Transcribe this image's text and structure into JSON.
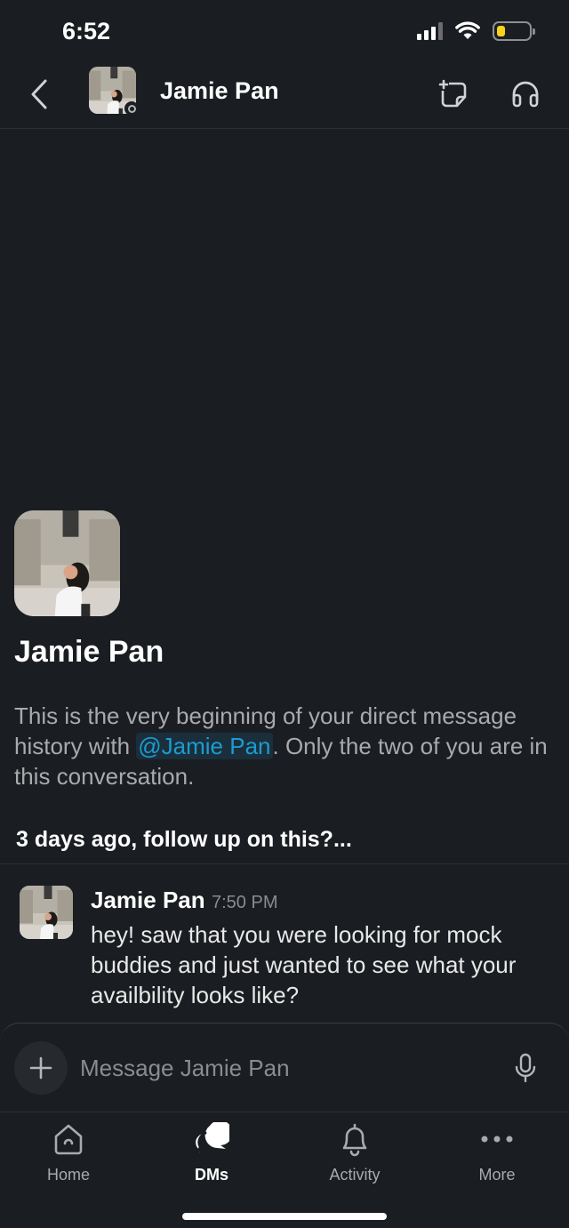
{
  "status_bar": {
    "time": "6:52",
    "battery_level": 0.22
  },
  "header": {
    "title": "Jamie Pan",
    "avatar_icon": "profile-photo",
    "presence": "away"
  },
  "intro": {
    "name": "Jamie Pan",
    "text_before": "This is the very beginning of your direct message history with ",
    "mention": "@Jamie Pan",
    "text_after": ". Only the two of you are in this conversation."
  },
  "thread": {
    "title": "3 days ago, follow up on this?...",
    "messages": [
      {
        "author": "Jamie Pan",
        "time": "7:50 PM",
        "text": "hey! saw that you were looking for mock buddies and just wanted to see what your availbility looks like?"
      }
    ]
  },
  "composer": {
    "placeholder": "Message Jamie Pan"
  },
  "tabs": [
    {
      "label": "Home",
      "icon": "home-icon",
      "active": false
    },
    {
      "label": "DMs",
      "icon": "dms-icon",
      "active": true
    },
    {
      "label": "Activity",
      "icon": "bell-icon",
      "active": false
    },
    {
      "label": "More",
      "icon": "more-icon",
      "active": false
    }
  ],
  "colors": {
    "background": "#1a1d21",
    "mention": "#1d9bd1",
    "battery": "#f7d21a"
  }
}
